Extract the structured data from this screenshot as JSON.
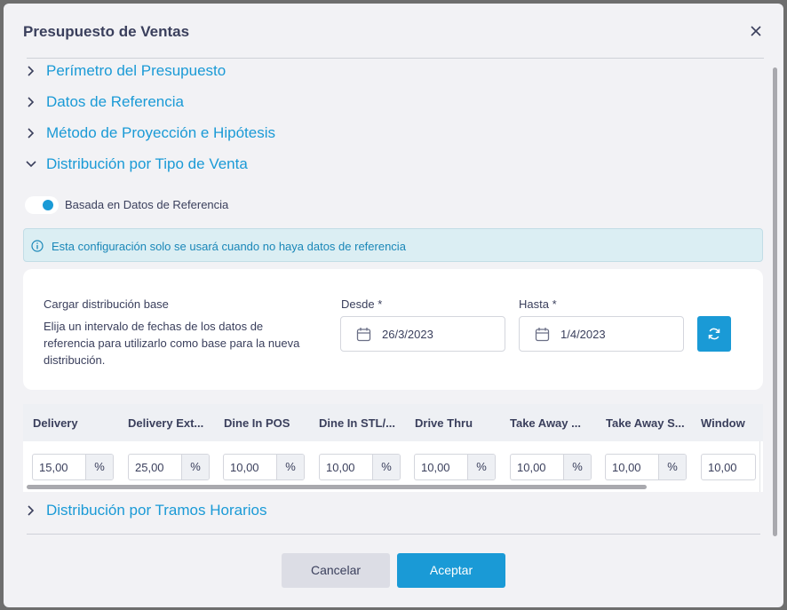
{
  "dialog": {
    "title": "Presupuesto de Ventas"
  },
  "sections": [
    {
      "label": "Perímetro del Presupuesto",
      "expanded": false
    },
    {
      "label": "Datos de Referencia",
      "expanded": false
    },
    {
      "label": "Método de Proyección e Hipótesis",
      "expanded": false
    },
    {
      "label": "Distribución por Tipo de Venta",
      "expanded": true
    },
    {
      "label": "Distribución por Tramos Horarios",
      "expanded": false
    }
  ],
  "toggle": {
    "label": "Basada en Datos de Referencia",
    "on": true
  },
  "info": {
    "text": "Esta configuración solo se usará cuando no haya datos de referencia"
  },
  "base_card": {
    "title": "Cargar distribución base",
    "description": "Elija un intervalo de fechas de los datos de referencia para utilizarlo como base para la nueva distribución.",
    "from_label": "Desde *",
    "from_value": "26/3/2023",
    "to_label": "Hasta *",
    "to_value": "1/4/2023"
  },
  "grid": {
    "columns": [
      {
        "header": "Delivery",
        "value": "15,00"
      },
      {
        "header": "Delivery Ext...",
        "value": "25,00"
      },
      {
        "header": "Dine In POS",
        "value": "10,00"
      },
      {
        "header": "Dine In STL/...",
        "value": "10,00"
      },
      {
        "header": "Drive Thru",
        "value": "10,00"
      },
      {
        "header": "Take Away ...",
        "value": "10,00"
      },
      {
        "header": "Take Away S...",
        "value": "10,00"
      },
      {
        "header": "Window",
        "value": "10,00"
      }
    ],
    "unit": "%"
  },
  "footer": {
    "cancel_label": "Cancelar",
    "ok_label": "Aceptar"
  },
  "colors": {
    "accent": "#1a9ad6",
    "text": "#3a3f5c",
    "info_bg": "#dbeef3"
  },
  "icons": [
    "close-icon",
    "chevron-right-icon",
    "chevron-down-icon",
    "info-icon",
    "calendar-icon",
    "refresh-icon"
  ]
}
